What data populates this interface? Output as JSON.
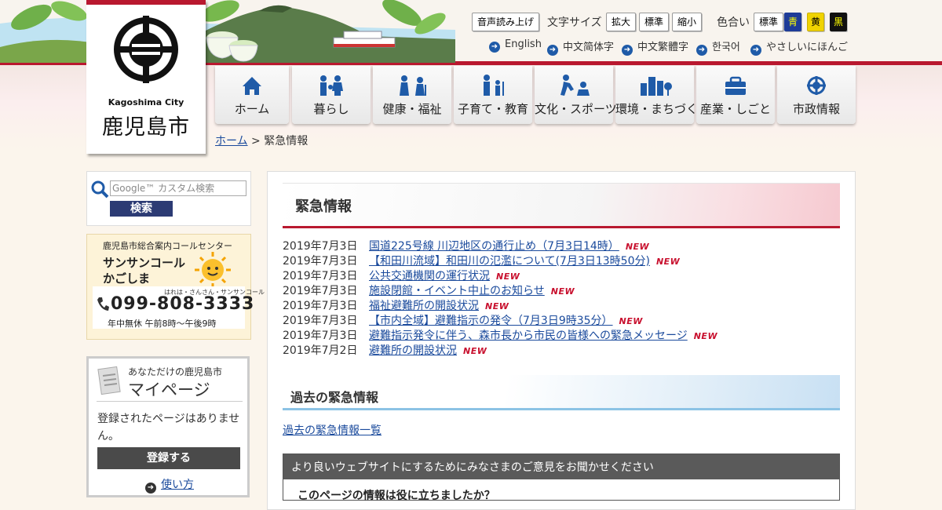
{
  "header": {
    "logo": {
      "city_en": "Kagoshima City",
      "city_ja": "鹿児島市"
    },
    "toolbar": {
      "read_aloud": "音声読み上げ",
      "font_size_label": "文字サイズ",
      "font_size_buttons": [
        "拡大",
        "標準",
        "縮小"
      ],
      "color_label": "色合い",
      "color_buttons": [
        "標準",
        "青",
        "黄",
        "黒"
      ],
      "colors": {
        "standard": "#ffffff",
        "blue": "#1e3c98",
        "yellow": "#f0d300",
        "black": "#111111"
      }
    },
    "languages": [
      "English",
      "中文简体字",
      "中文繁體字",
      "한국어",
      "やさしいにほんご"
    ]
  },
  "nav": [
    {
      "label": "ホーム",
      "icon": "home-icon"
    },
    {
      "label": "暮らし",
      "icon": "family-icon"
    },
    {
      "label": "健康・福祉",
      "icon": "welfare-icon"
    },
    {
      "label": "子育て・教育",
      "icon": "parenting-icon"
    },
    {
      "label": "文化・スポーツ",
      "icon": "sports-icon"
    },
    {
      "label": "環境・まちづくり",
      "icon": "city-icon"
    },
    {
      "label": "産業・しごと",
      "icon": "briefcase-icon"
    },
    {
      "label": "市政情報",
      "icon": "city-emblem-icon"
    }
  ],
  "breadcrumb": {
    "home": "ホーム",
    "separator": ">",
    "current": "緊急情報"
  },
  "sidebar": {
    "search": {
      "placeholder": "Google™ カスタム検索",
      "button": "検索"
    },
    "call_center": {
      "title": "鹿児島市総合案内コールセンター",
      "name_line1": "サンサンコール",
      "name_line2": "かごしま",
      "reading": "はれは・さんさん・サンサンコール",
      "phone": "099-808-3333",
      "hours": "年中無休 午前8時～午後9時"
    },
    "mypage": {
      "subtitle": "あなただけの鹿児島市",
      "title": "マイページ",
      "empty_text": "登録されたページはありません。",
      "register_button": "登録する",
      "howto": "使い方"
    }
  },
  "main": {
    "title": "緊急情報",
    "new_label": "NEW",
    "news": [
      {
        "date": "2019年7月3日",
        "title": "国道225号線 川辺地区の通行止め（7月3日14時）"
      },
      {
        "date": "2019年7月3日",
        "title": "【和田川流域】和田川の氾濫について(7月3日13時50分)"
      },
      {
        "date": "2019年7月3日",
        "title": "公共交通機関の運行状況"
      },
      {
        "date": "2019年7月3日",
        "title": "施設閉館・イベント中止のお知らせ"
      },
      {
        "date": "2019年7月3日",
        "title": "福祉避難所の開設状況"
      },
      {
        "date": "2019年7月3日",
        "title": "【市内全域】避難指示の発令（7月3日9時35分）"
      },
      {
        "date": "2019年7月3日",
        "title": "避難指示発令に伴う、森市長から市民の皆様への緊急メッセージ"
      },
      {
        "date": "2019年7月2日",
        "title": "避難所の開設状況"
      }
    ],
    "past_heading": "過去の緊急情報",
    "past_link": "過去の緊急情報一覧",
    "survey": {
      "heading": "より良いウェブサイトにするためにみなさまのご意見をお聞かせください",
      "question": "このページの情報は役に立ちましたか？"
    }
  }
}
